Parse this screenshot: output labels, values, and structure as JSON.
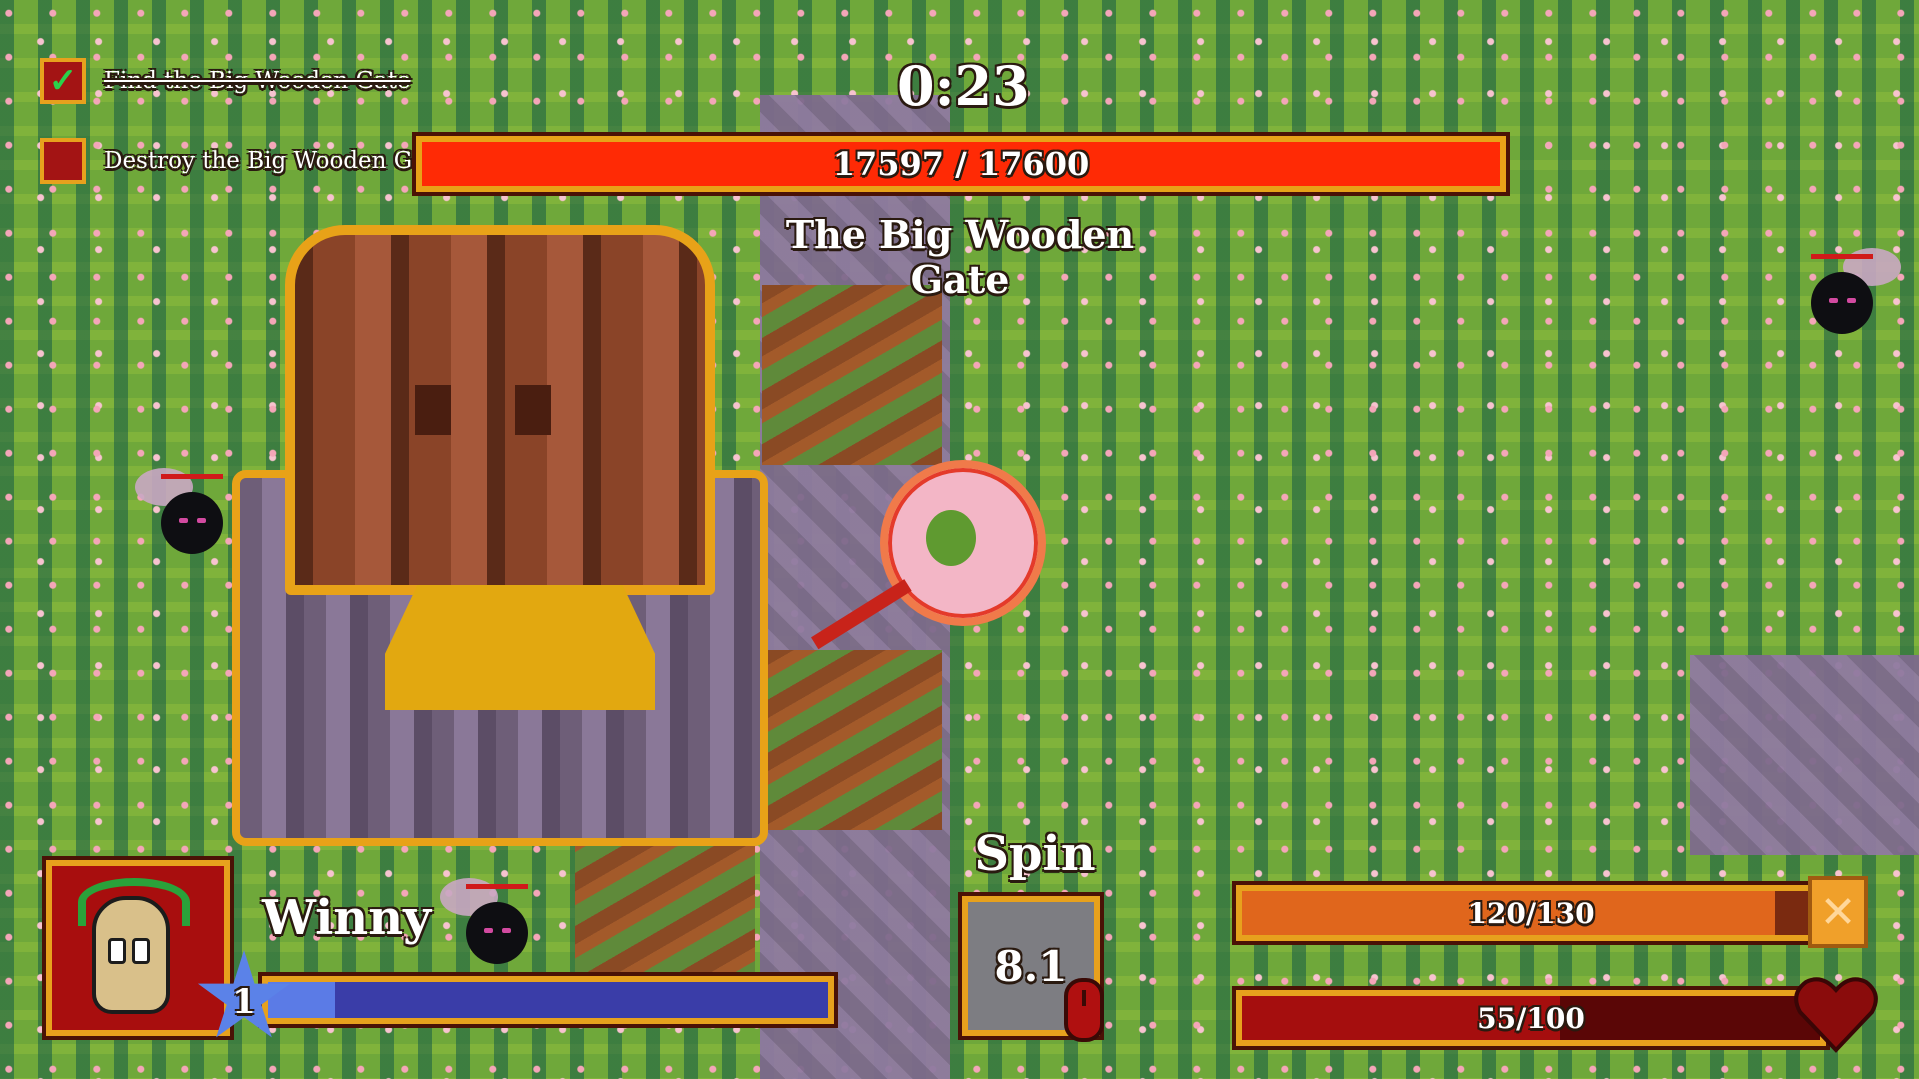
{
  "objectives": [
    {
      "label": "Find the Big Wooden Gate",
      "done": true
    },
    {
      "label": "Destroy the Big Wooden Gate",
      "done": false
    }
  ],
  "timer": "0:23",
  "boss": {
    "name": "The Big Wooden Gate",
    "hp_text": "17597 / 17600",
    "hp_current": 17597,
    "hp_max": 17600,
    "bar_color": "#ff2a05"
  },
  "player": {
    "name": "Winny",
    "level": "1",
    "xp_fraction": 0.12,
    "portrait_icon": "character-portrait"
  },
  "ability": {
    "label": "Spin",
    "cooldown": "8.1",
    "input_icon": "mouse-icon"
  },
  "stamina": {
    "text": "120/130",
    "fraction": 0.923,
    "icon": "stamina-icon",
    "color": "#e0661c"
  },
  "health": {
    "text": "55/100",
    "fraction": 0.55,
    "icon": "heart-icon",
    "color": "#a50e0e"
  }
}
